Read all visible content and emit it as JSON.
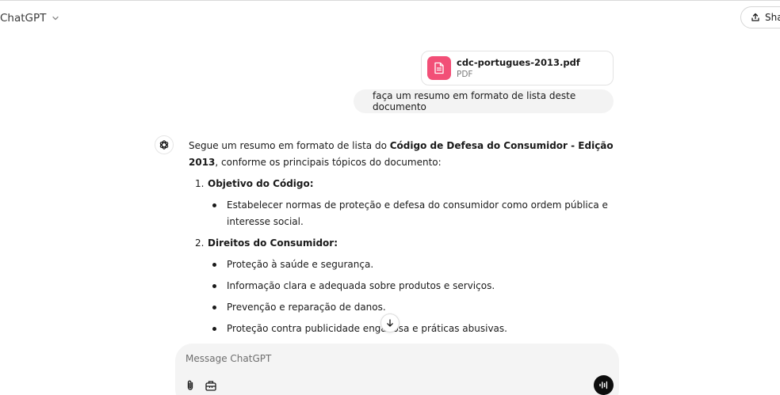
{
  "header": {
    "model_name": "ChatGPT",
    "share_label": "Shar"
  },
  "attachment": {
    "file_name": "cdc-portugues-2013.pdf",
    "file_type": "PDF",
    "icon": "document-icon",
    "icon_bg": "#f24f77"
  },
  "user_message": "faça um resumo em formato de lista deste documento",
  "assistant": {
    "intro_before": "Segue um resumo em formato de lista do ",
    "intro_bold": "Código de Defesa do Consumidor - Edição 2013",
    "intro_after": ", conforme os principais tópicos do documento:",
    "sections": [
      {
        "number": "1.",
        "title": "Objetivo do Código",
        "colon": ":",
        "points": [
          "Estabelecer normas de proteção e defesa do consumidor como ordem pública e interesse social."
        ]
      },
      {
        "number": "2.",
        "title": "Direitos do Consumidor",
        "colon": ":",
        "points": [
          "Proteção à saúde e segurança.",
          "Informação clara e adequada sobre produtos e serviços.",
          "Prevenção e reparação de danos.",
          "Proteção contra publicidade enganosa e práticas abusivas."
        ]
      }
    ]
  },
  "composer": {
    "placeholder": "Message ChatGPT"
  }
}
